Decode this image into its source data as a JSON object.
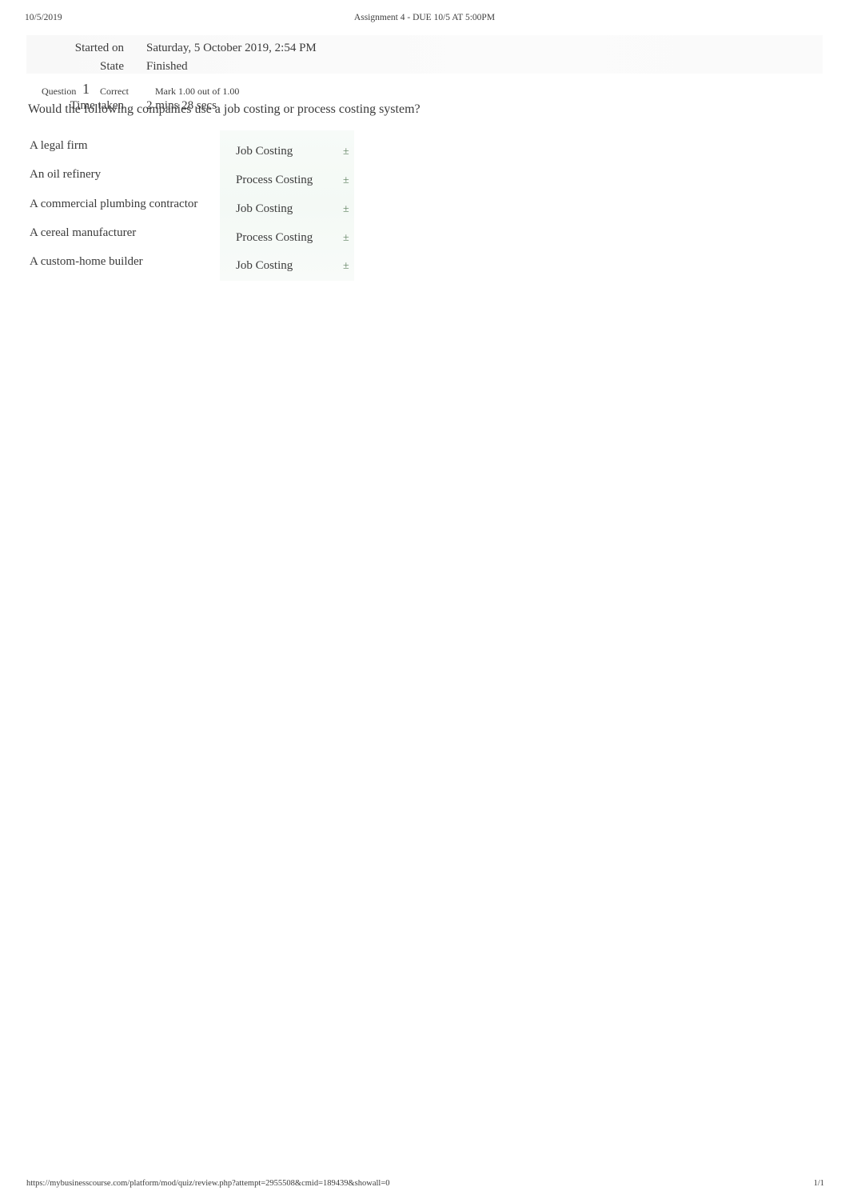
{
  "print_header": {
    "date": "10/5/2019",
    "document_title": "Assignment 4 - DUE 10/5 AT 5:00PM"
  },
  "attempt_summary": {
    "rows": [
      {
        "label": "Started on",
        "value": "Saturday, 5 October 2019, 2:54 PM"
      },
      {
        "label": "State",
        "value": "Finished"
      }
    ],
    "time_taken": {
      "label": "Time taken",
      "value": "2 mins 28 secs"
    }
  },
  "question": {
    "question_word": "Question",
    "number": "1",
    "state": "Correct",
    "mark": "Mark 1.00 out of 1.00",
    "stem": "Would the following companies use a job costing or process costing system?"
  },
  "matching": {
    "correct_mark_glyph": "±",
    "correct_mark_color": "#5d7f5d",
    "panel_color": "#f5faf6",
    "rows": [
      {
        "term": "A legal firm",
        "answer": "Job Costing",
        "mark": "±"
      },
      {
        "term": "An oil refinery",
        "answer": "Process Costing",
        "mark": "±"
      },
      {
        "term": "A commercial plumbing contractor",
        "answer": "Job Costing",
        "mark": "±"
      },
      {
        "term": "A cereal manufacturer",
        "answer": "Process Costing",
        "mark": "±"
      },
      {
        "term": "A custom-home builder",
        "answer": "Job Costing",
        "mark": "±"
      }
    ]
  },
  "print_footer": {
    "url": "https://mybusinesscourse.com/platform/mod/quiz/review.php?attempt=2955508&cmid=189439&showall=0",
    "page": "1/1"
  }
}
